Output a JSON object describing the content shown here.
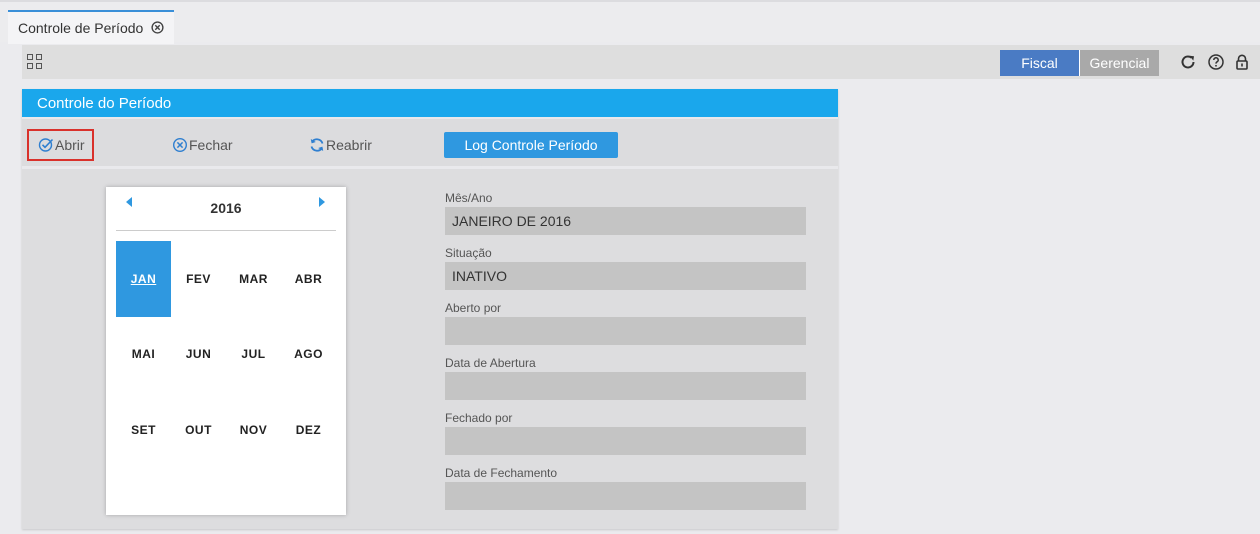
{
  "tab": {
    "label": "Controle de Período"
  },
  "toolbar": {
    "modes": [
      "Fiscal",
      "Gerencial"
    ],
    "icons": [
      "grid-icon",
      "refresh-icon",
      "help-icon",
      "lock-icon"
    ]
  },
  "panel": {
    "title": "Controle do Período",
    "actions": {
      "abrir": "Abrir",
      "fechar": "Fechar",
      "reabrir": "Reabrir",
      "log": "Log Controle Período"
    },
    "calendar": {
      "year": "2016",
      "months": [
        "JAN",
        "FEV",
        "MAR",
        "ABR",
        "MAI",
        "JUN",
        "JUL",
        "AGO",
        "SET",
        "OUT",
        "NOV",
        "DEZ"
      ],
      "selected": "JAN"
    },
    "fields": [
      {
        "label": "Mês/Ano",
        "value": "JANEIRO DE 2016"
      },
      {
        "label": "Situação",
        "value": "INATIVO"
      },
      {
        "label": "Aberto por",
        "value": ""
      },
      {
        "label": "Data de Abertura",
        "value": ""
      },
      {
        "label": "Fechado por",
        "value": ""
      },
      {
        "label": "Data de Fechamento",
        "value": ""
      }
    ]
  },
  "colors": {
    "accent": "#2f98e0",
    "header": "#1aa7ec",
    "fiscal": "#4a7bc4",
    "highlight": "#d9312b"
  }
}
